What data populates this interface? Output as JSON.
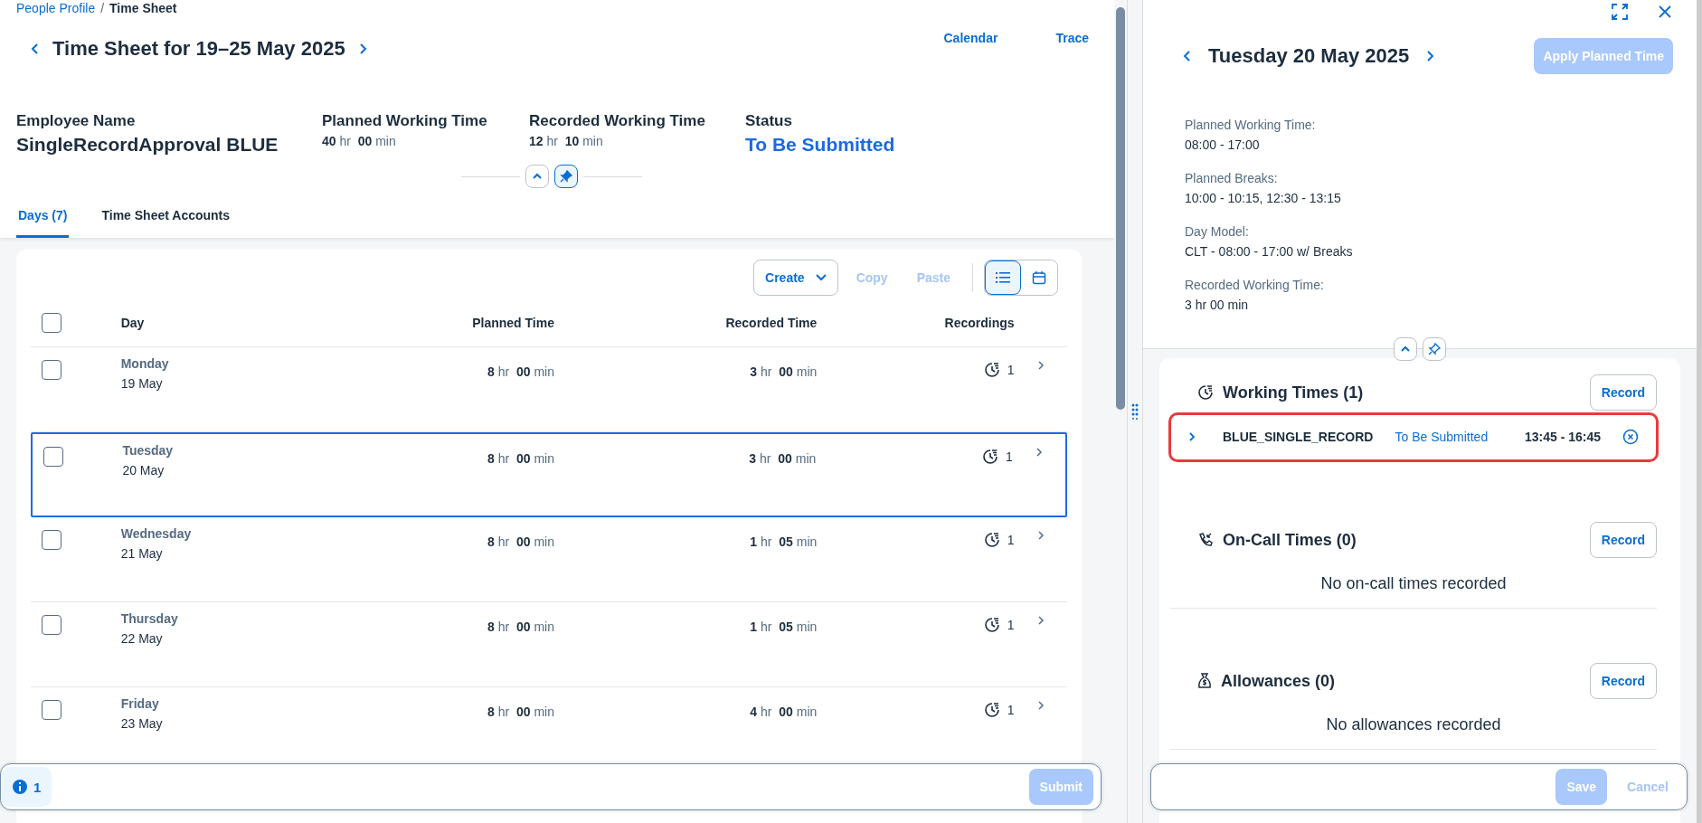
{
  "breadcrumb": {
    "link": "People Profile",
    "separator": "/",
    "current": "Time Sheet"
  },
  "title": "Time Sheet for 19–25 May 2025",
  "header_links": [
    "Calendar",
    "Trace"
  ],
  "header_fields": [
    {
      "label": "Employee Name",
      "value": "SingleRecordApproval BLUE",
      "kind": "name"
    },
    {
      "label": "Planned Working Time",
      "value": "**40** hr  **00** min",
      "kind": "time"
    },
    {
      "label": "Recorded Working Time",
      "value": "**12** hr  **10** min",
      "kind": "time"
    },
    {
      "label": "Status",
      "value": "To Be Submitted",
      "kind": "status"
    }
  ],
  "tabs": [
    {
      "label": "Days (7)",
      "selected": true
    },
    {
      "label": "Time Sheet Accounts",
      "selected": false
    }
  ],
  "toolbar": {
    "create": "Create",
    "copy": {
      "label": "Copy",
      "disabled": true
    },
    "paste": {
      "label": "Paste",
      "disabled": true
    },
    "views": [
      {
        "kind": "list",
        "selected": true
      },
      {
        "kind": "calendar",
        "selected": false
      }
    ]
  },
  "table": {
    "columns": [
      "Day",
      "Planned Time",
      "Recorded Time",
      "Recordings"
    ],
    "header_checked": false,
    "rows": [
      {
        "weekday": "Monday",
        "date": "19 May",
        "planned": "**8** hr  **00** min",
        "recorded": "**3** hr  **00** min",
        "recordings": "1",
        "checked": false,
        "selected": false
      },
      {
        "weekday": "Tuesday",
        "date": "20 May",
        "planned": "**8** hr  **00** min",
        "recorded": "**3** hr  **00** min",
        "recordings": "1",
        "checked": false,
        "selected": true
      },
      {
        "weekday": "Wednesday",
        "date": "21 May",
        "planned": "**8** hr  **00** min",
        "recorded": "**1** hr  **05** min",
        "recordings": "1",
        "checked": false,
        "selected": false
      },
      {
        "weekday": "Thursday",
        "date": "22 May",
        "planned": "**8** hr  **00** min",
        "recorded": "**1** hr  **05** min",
        "recordings": "1",
        "checked": false,
        "selected": false
      },
      {
        "weekday": "Friday",
        "date": "23 May",
        "planned": "**8** hr  **00** min",
        "recorded": "**4** hr  **00** min",
        "recordings": "1",
        "checked": false,
        "selected": false
      }
    ]
  },
  "footer": {
    "messages": "1",
    "submit": {
      "label": "Submit",
      "disabled": true
    }
  },
  "detail": {
    "title": "Tuesday 20 May 2025",
    "apply": {
      "label": "Apply Planned Time",
      "disabled": true
    },
    "info": [
      {
        "label": "Planned Working Time:",
        "value": "08:00 - 17:00"
      },
      {
        "label": "Planned Breaks:",
        "value": "10:00 - 10:15, 12:30 - 13:15"
      },
      {
        "label": "Day Model:",
        "value": "CLT - 08:00 - 17:00 w/ Breaks"
      },
      {
        "label": "Recorded Working Time:",
        "value": "3 hr 00 min"
      }
    ],
    "sections": [
      {
        "kind": "working",
        "title": "Working Times (1)",
        "button": "Record",
        "records": [
          {
            "name": "BLUE_SINGLE_RECORD",
            "status": "To Be Submitted",
            "time": "13:45 - 16:45",
            "highlighted": true
          }
        ]
      },
      {
        "kind": "oncall",
        "title": "On-Call Times (0)",
        "button": "Record",
        "empty": "No on-call times recorded"
      },
      {
        "kind": "allowance",
        "title": "Allowances (0)",
        "button": "Record",
        "empty": "No allowances recorded"
      }
    ],
    "footer": {
      "save": {
        "label": "Save",
        "disabled": true
      },
      "cancel": {
        "label": "Cancel",
        "disabled": true
      }
    }
  }
}
